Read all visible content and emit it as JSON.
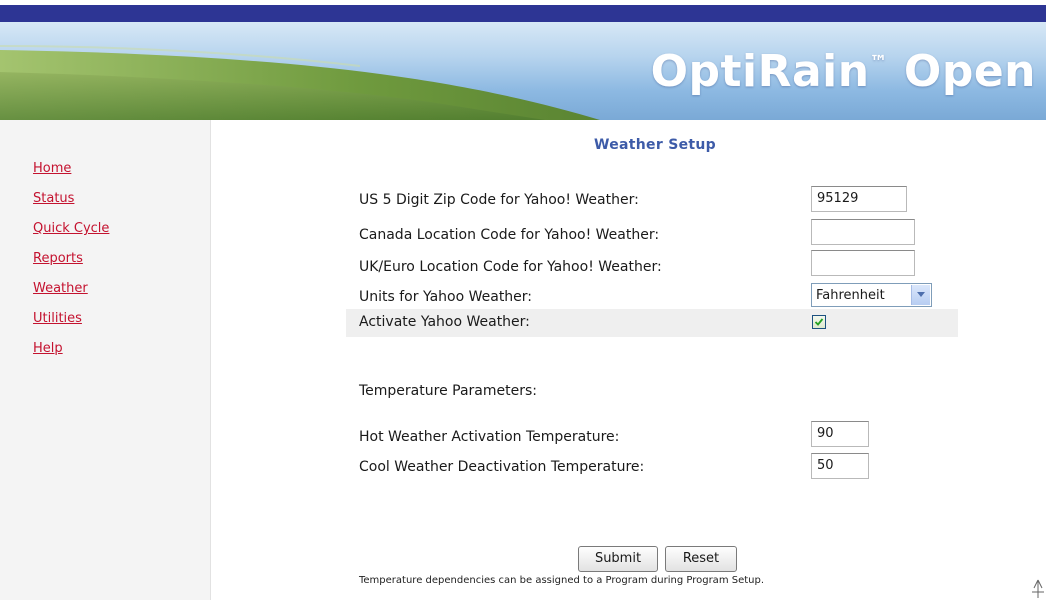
{
  "banner": {
    "brand": "OptiRain",
    "trademark": "™",
    "brand_suffix": "Open"
  },
  "sidebar": {
    "items": [
      {
        "label": "Home"
      },
      {
        "label": "Status"
      },
      {
        "label": "Quick Cycle"
      },
      {
        "label": "Reports"
      },
      {
        "label": "Weather"
      },
      {
        "label": "Utilities"
      },
      {
        "label": "Help"
      }
    ]
  },
  "page": {
    "title": "Weather Setup"
  },
  "form": {
    "zip": {
      "label": "US 5 Digit Zip Code for Yahoo! Weather:",
      "value": "95129"
    },
    "canada": {
      "label": "Canada Location Code for Yahoo! Weather:",
      "value": ""
    },
    "uk": {
      "label": "UK/Euro Location Code for Yahoo! Weather:",
      "value": ""
    },
    "units": {
      "label": "Units for Yahoo Weather:",
      "selected": "Fahrenheit"
    },
    "activate": {
      "label": "Activate Yahoo Weather:",
      "checked": true
    },
    "temp_heading": "Temperature Parameters:",
    "hot": {
      "label": "Hot Weather Activation Temperature:",
      "value": "90"
    },
    "cool": {
      "label": "Cool Weather Deactivation Temperature:",
      "value": "50"
    },
    "submit_label": "Submit",
    "reset_label": "Reset"
  },
  "footer": {
    "note": "Temperature dependencies can be assigned to a Program during Program Setup."
  },
  "colors": {
    "nav_link": "#c4122f",
    "title": "#3d5ba8",
    "top_bar": "#2d3594"
  },
  "icons": {
    "select_arrow": "chevron-down-icon",
    "checkbox": "checkmark-icon"
  }
}
